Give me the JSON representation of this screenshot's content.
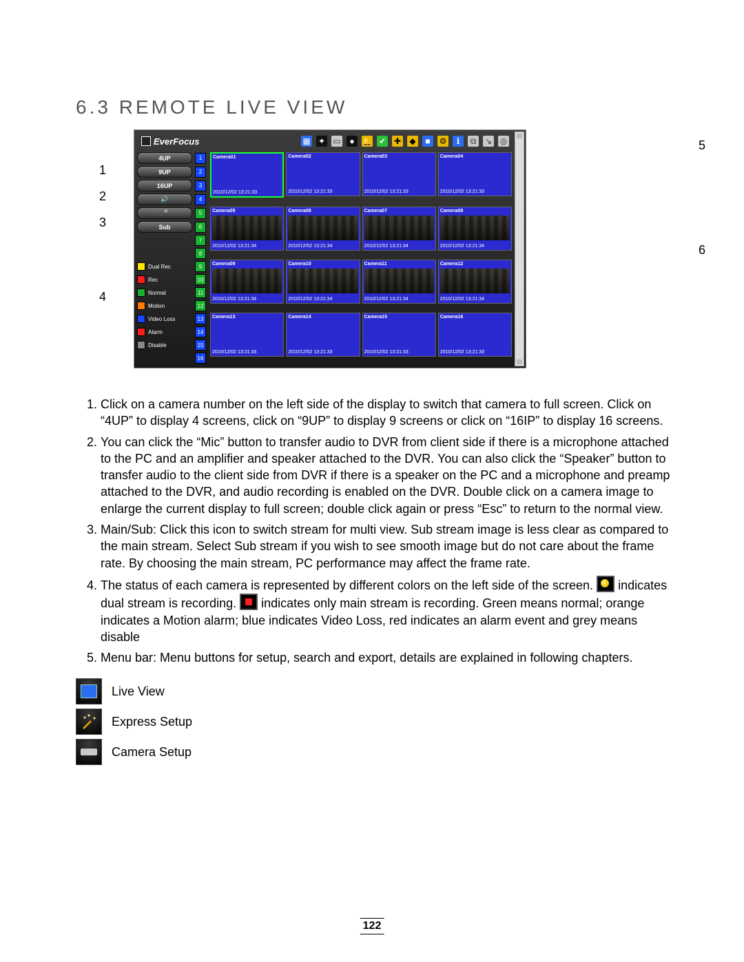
{
  "section_title": "6.3  REMOTE LIVE VIEW",
  "callouts": {
    "left": [
      "1",
      "2",
      "3",
      "4"
    ],
    "right": [
      "5",
      "6"
    ]
  },
  "app": {
    "brand": "EverFocus",
    "menu_icons": [
      "live-view-icon",
      "wand-icon",
      "camera-icon",
      "record-icon",
      "alarm-icon",
      "schedule-icon",
      "network-icon",
      "disk-icon",
      "display-icon",
      "system-icon",
      "info-icon",
      "copy-icon",
      "logout-icon",
      "fingerprint-icon"
    ],
    "layout_buttons": [
      "4UP",
      "9UP",
      "16UP"
    ],
    "audio_buttons": [
      "mic-icon",
      "speaker-icon"
    ],
    "stream_button": "Sub",
    "camera_slots": [
      "1",
      "2",
      "3",
      "4",
      "5",
      "6",
      "7",
      "8",
      "9",
      "10",
      "11",
      "12",
      "13",
      "14",
      "15",
      "16"
    ],
    "legend": [
      {
        "label": "Dual Rec",
        "color": "sw-yellow"
      },
      {
        "label": "Rec",
        "color": "sw-red"
      },
      {
        "label": "Normal",
        "color": "sw-green"
      },
      {
        "label": "Motion",
        "color": "sw-orange"
      },
      {
        "label": "Video Loss",
        "color": "sw-blue"
      },
      {
        "label": "Alarm",
        "color": "sw-red2"
      },
      {
        "label": "Disable",
        "color": "sw-grey"
      }
    ],
    "tiles": [
      {
        "name": "Camera01",
        "ts": "2010/12/02 13:21:33",
        "room": false,
        "sel": true
      },
      {
        "name": "Camera02",
        "ts": "2010/12/02 13:21:33",
        "room": false
      },
      {
        "name": "Camera03",
        "ts": "2010/12/02 13:21:33",
        "room": false
      },
      {
        "name": "Camera04",
        "ts": "2010/12/02 13:21:33",
        "room": false
      },
      {
        "name": "Camera05",
        "ts": "2010/12/02 13:21:34",
        "room": true
      },
      {
        "name": "Camera06",
        "ts": "2010/12/02 13:21:34",
        "room": true
      },
      {
        "name": "Camera07",
        "ts": "2010/12/02 13:21:34",
        "room": true
      },
      {
        "name": "Camera08",
        "ts": "2010/12/02 13:21:34",
        "room": true
      },
      {
        "name": "Camera09",
        "ts": "2010/12/02 13:21:34",
        "room": true
      },
      {
        "name": "Camera10",
        "ts": "2010/12/02 13:21:34",
        "room": true
      },
      {
        "name": "Camera11",
        "ts": "2010/12/02 13:21:34",
        "room": true
      },
      {
        "name": "Camera12",
        "ts": "2010/12/02 13:21:34",
        "room": true
      },
      {
        "name": "Camera13",
        "ts": "2010/12/02 13:21:33",
        "room": false
      },
      {
        "name": "Camera14",
        "ts": "2010/12/02 13:21:33",
        "room": false
      },
      {
        "name": "Camera15",
        "ts": "2010/12/02 13:21:33",
        "room": false
      },
      {
        "name": "Camera16",
        "ts": "2010/12/02 13:21:33",
        "room": false
      }
    ]
  },
  "instructions": {
    "i1": "Click on a camera number on the left side of the display to switch that camera to full screen. Click on “4UP” to display 4 screens, click on “9UP” to display 9 screens or click on “16IP” to display 16 screens.",
    "i2": "You can click the “Mic” button to transfer audio to DVR from client side if there is a microphone attached to the PC and an amplifier and speaker attached to the DVR. You can also click the “Speaker” button to transfer audio to the client side from DVR if there is a speaker on the PC and a microphone and preamp attached to the DVR, and audio recording is enabled on the DVR. Double click on a camera image to enlarge the current display to full screen; double click again or press “Esc” to return to the normal view.",
    "i3": "Main/Sub: Click this icon to switch stream for multi view.  Sub stream image is less clear as compared to the main stream.  Select Sub stream if you wish to see smooth image but do not care about the frame rate. By choosing the main stream, PC performance may affect the frame rate.",
    "i4a": "The status of each camera is represented by different colors on the left side of the screen.",
    "i4b": "indicates dual stream is recording.",
    "i4c": "indicates only main stream is recording. Green means normal; orange indicates a Motion alarm; blue indicates Video Loss, red indicates an alarm event and grey means disable",
    "i5": "Menu bar: Menu buttons for setup, search and export, details are explained in following chapters."
  },
  "icon_legend": [
    {
      "label": "Live View",
      "icon": "live"
    },
    {
      "label": "Express Setup",
      "icon": "wand"
    },
    {
      "label": "Camera Setup",
      "icon": "cam"
    }
  ],
  "page_number": "122"
}
